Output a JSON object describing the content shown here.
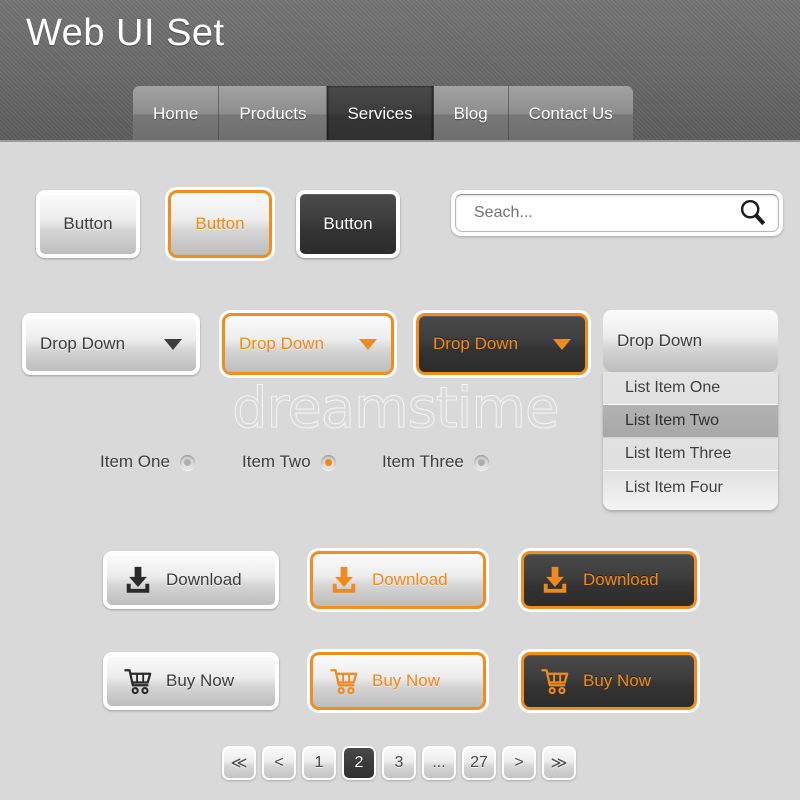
{
  "header": {
    "title": "Web UI Set",
    "nav": [
      {
        "label": "Home",
        "state": "normal"
      },
      {
        "label": "Products",
        "state": "normal"
      },
      {
        "label": "Services",
        "state": "active"
      },
      {
        "label": "Blog",
        "state": "normal"
      },
      {
        "label": "Contact Us",
        "state": "normal"
      }
    ]
  },
  "watermark": {
    "text": "dreamstime"
  },
  "buttons": [
    {
      "label": "Button",
      "style": "light"
    },
    {
      "label": "Button",
      "style": "orange"
    },
    {
      "label": "Button",
      "style": "dark"
    }
  ],
  "search": {
    "value": "",
    "placeholder": "Seach...",
    "icon": "search-icon"
  },
  "dropdowns": [
    {
      "label": "Drop Down",
      "style": "light"
    },
    {
      "label": "Drop Down",
      "style": "orange"
    },
    {
      "label": "Drop Down",
      "style": "darkorange"
    },
    {
      "label": "Drop Down",
      "style": "light"
    }
  ],
  "dropdown_open": {
    "label": "Drop Down",
    "items": [
      {
        "label": "List Item One",
        "selected": false
      },
      {
        "label": "List Item Two",
        "selected": true
      },
      {
        "label": "List Item Three",
        "selected": false
      },
      {
        "label": "List Item Four",
        "selected": false
      }
    ]
  },
  "radios": [
    {
      "label": "Item One",
      "selected": false
    },
    {
      "label": "Item Two",
      "selected": true
    },
    {
      "label": "Item Three",
      "selected": false
    }
  ],
  "download_buttons": [
    {
      "label": "Download",
      "style": "light",
      "icon": "download-icon"
    },
    {
      "label": "Download",
      "style": "orange",
      "icon": "download-icon"
    },
    {
      "label": "Download",
      "style": "darkorange",
      "icon": "download-icon"
    }
  ],
  "buy_buttons": [
    {
      "label": "Buy Now",
      "style": "light",
      "icon": "cart-icon"
    },
    {
      "label": "Buy Now",
      "style": "orange",
      "icon": "cart-icon"
    },
    {
      "label": "Buy Now",
      "style": "darkorange",
      "icon": "cart-icon"
    }
  ],
  "pagination": [
    {
      "label": "≪",
      "name": "first",
      "active": false
    },
    {
      "label": "<",
      "name": "prev",
      "active": false
    },
    {
      "label": "1",
      "name": "page-1",
      "active": false
    },
    {
      "label": "2",
      "name": "page-2",
      "active": true
    },
    {
      "label": "3",
      "name": "page-3",
      "active": false
    },
    {
      "label": "...",
      "name": "ellipsis",
      "active": false
    },
    {
      "label": "27",
      "name": "page-27",
      "active": false
    },
    {
      "label": ">",
      "name": "next",
      "active": false
    },
    {
      "label": "≫",
      "name": "last",
      "active": false
    }
  ],
  "colors": {
    "accent_orange": "#f08a1c",
    "dark": "#3a3a3a",
    "background": "#d9d9d9",
    "header": "#6b6b6b"
  }
}
